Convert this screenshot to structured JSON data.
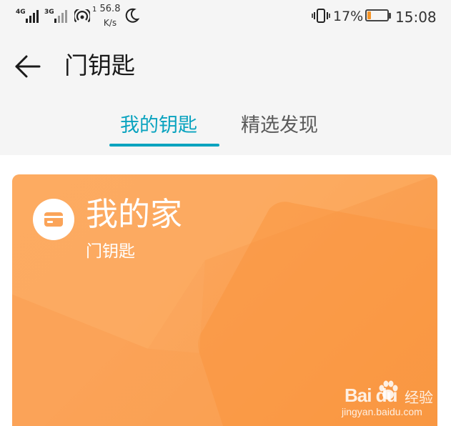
{
  "status_bar": {
    "sim1_network": "4G",
    "sim2_network": "3G",
    "speed_up_marker": "1",
    "speed_value": "56.8",
    "speed_unit": "K/s",
    "battery_percent": "17%",
    "battery_level": 0.17,
    "time": "15:08"
  },
  "header": {
    "title": "门钥匙"
  },
  "tabs": [
    {
      "label": "我的钥匙",
      "active": true
    },
    {
      "label": "精选发现",
      "active": false
    }
  ],
  "card": {
    "title": "我的家",
    "subtitle": "门钥匙",
    "icon": "card-icon"
  },
  "watermark": {
    "logo": "Bai du",
    "brand_suffix": "经验",
    "url": "jingyan.baidu.com"
  },
  "colors": {
    "accent": "#0aa3bf",
    "card": "#fba459",
    "battery_low": "#f59427"
  }
}
